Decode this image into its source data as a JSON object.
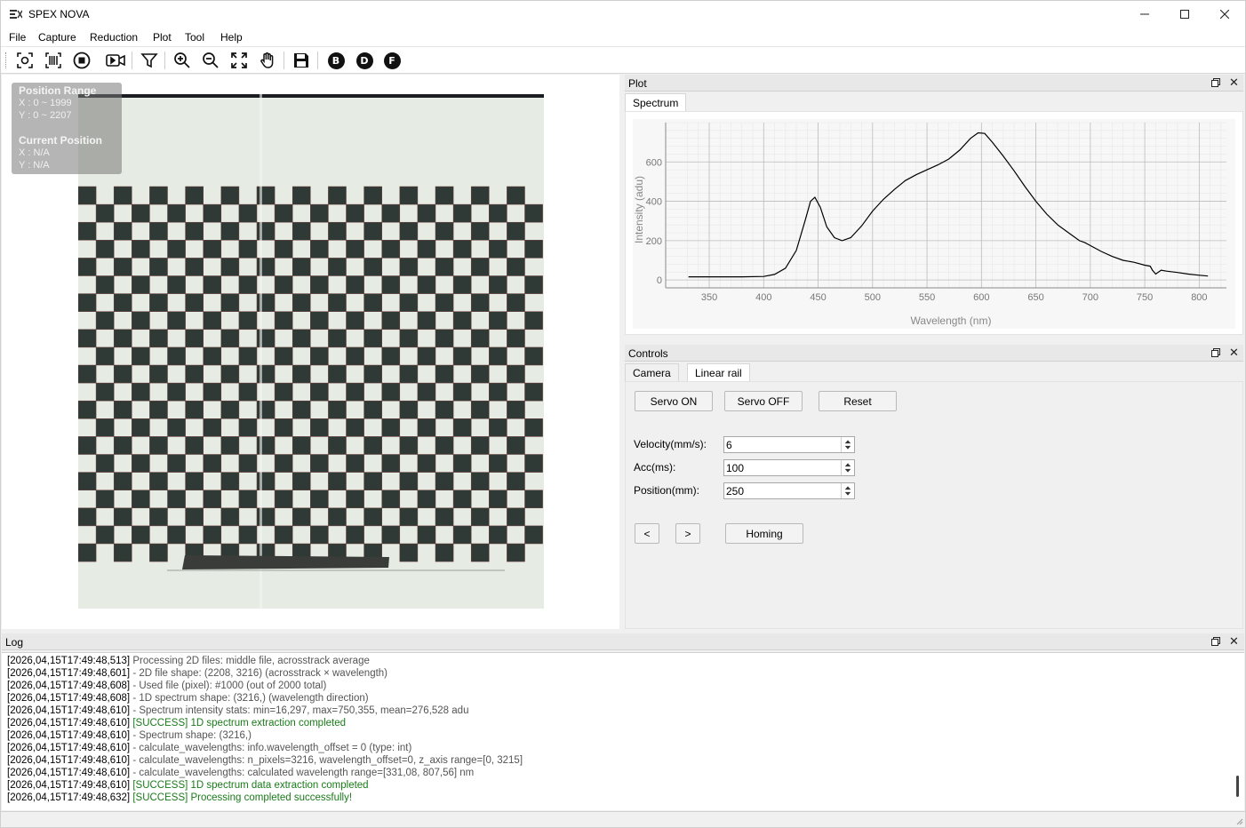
{
  "window": {
    "title": "SPEX NOVA"
  },
  "menu": [
    "File",
    "Capture",
    "Reduction",
    "Plot",
    "Tool",
    "Help"
  ],
  "toolbar": {
    "icons": [
      "capture-icon",
      "barcode-icon",
      "stop-icon",
      "video-icon",
      "filter-icon",
      "zoom-in-icon",
      "zoom-out-icon",
      "fit-icon",
      "pan-hand-icon",
      "save-icon"
    ],
    "letters": [
      "B",
      "D",
      "F"
    ]
  },
  "image_overlay": {
    "range_title": "Position Range",
    "range_x": "X : 0 ~ 1999",
    "range_y": "Y : 0 ~ 2207",
    "current_title": "Current Position",
    "current_x": "X : N/A",
    "current_y": "Y : N/A"
  },
  "plot_panel": {
    "title": "Plot",
    "tab": "Spectrum"
  },
  "chart_data": {
    "type": "line",
    "xlabel": "Wavelength (nm)",
    "ylabel": "Intensity (adu)",
    "xlim": [
      310,
      825
    ],
    "ylim": [
      -40,
      800
    ],
    "xticks": [
      350,
      400,
      450,
      500,
      550,
      600,
      650,
      700,
      750,
      800
    ],
    "yticks": [
      0,
      200,
      400,
      600
    ],
    "grid": true,
    "series": [
      {
        "x": [
          331,
          350,
          380,
          400,
          410,
          420,
          430,
          438,
          443,
          447,
          452,
          458,
          465,
          472,
          480,
          490,
          500,
          510,
          520,
          530,
          540,
          550,
          560,
          570,
          580,
          590,
          597,
          603,
          610,
          620,
          630,
          640,
          650,
          660,
          670,
          680,
          690,
          695,
          700,
          710,
          720,
          730,
          740,
          750,
          755,
          757,
          760,
          765,
          770,
          780,
          790,
          800,
          808
        ],
        "y": [
          16,
          16,
          16,
          18,
          28,
          60,
          150,
          300,
          400,
          420,
          370,
          270,
          215,
          200,
          215,
          275,
          350,
          410,
          460,
          505,
          535,
          560,
          585,
          615,
          660,
          720,
          748,
          745,
          700,
          630,
          555,
          475,
          400,
          335,
          280,
          240,
          200,
          190,
          175,
          145,
          120,
          100,
          90,
          75,
          70,
          50,
          30,
          50,
          45,
          38,
          30,
          24,
          20
        ]
      }
    ]
  },
  "controls_panel": {
    "title": "Controls",
    "tabs": [
      "Camera",
      "Linear rail"
    ],
    "buttons": {
      "servo_on": "Servo ON",
      "servo_off": "Servo OFF",
      "reset": "Reset",
      "prev": "<",
      "next": ">",
      "homing": "Homing"
    },
    "fields": [
      {
        "label": "Velocity(mm/s):",
        "value": "6"
      },
      {
        "label": "Acc(ms):",
        "value": "100"
      },
      {
        "label": "Position(mm):",
        "value": "250"
      }
    ]
  },
  "log_panel": {
    "title": "Log",
    "lines": [
      {
        "ts": "[2026,04,15T17:49:48,513]",
        "msg": "Processing 2D files: middle file, acrosstrack average",
        "success": false
      },
      {
        "ts": "[2026,04,15T17:49:48,601]",
        "msg": "- 2D file shape: (2208, 3216) (acrosstrack × wavelength)",
        "success": false
      },
      {
        "ts": "[2026,04,15T17:49:48,608]",
        "msg": "- Used file (pixel): #1000 (out of 2000 total)",
        "success": false
      },
      {
        "ts": "[2026,04,15T17:49:48,608]",
        "msg": "- 1D spectrum shape: (3216,) (wavelength direction)",
        "success": false
      },
      {
        "ts": "[2026,04,15T17:49:48,610]",
        "msg": "- Spectrum intensity stats: min=16,297, max=750,355, mean=276,528 adu",
        "success": false
      },
      {
        "ts": "[2026,04,15T17:49:48,610]",
        "msg": "[SUCCESS] 1D spectrum extraction completed",
        "success": true
      },
      {
        "ts": "[2026,04,15T17:49:48,610]",
        "msg": "- Spectrum shape: (3216,)",
        "success": false
      },
      {
        "ts": "[2026,04,15T17:49:48,610]",
        "msg": "- calculate_wavelengths: info.wavelength_offset = 0 (type: int)",
        "success": false
      },
      {
        "ts": "[2026,04,15T17:49:48,610]",
        "msg": "- calculate_wavelengths: n_pixels=3216, wavelength_offset=0, z_axis range=[0, 3215]",
        "success": false
      },
      {
        "ts": "[2026,04,15T17:49:48,610]",
        "msg": "- calculate_wavelengths: calculated wavelength range=[331,08, 807,56] nm",
        "success": false
      },
      {
        "ts": "[2026,04,15T17:49:48,610]",
        "msg": "[SUCCESS] 1D spectrum data extraction completed",
        "success": true
      },
      {
        "ts": "[2026,04,15T17:49:48,632]",
        "msg": "[SUCCESS] Processing completed successfully!",
        "success": true
      }
    ]
  }
}
